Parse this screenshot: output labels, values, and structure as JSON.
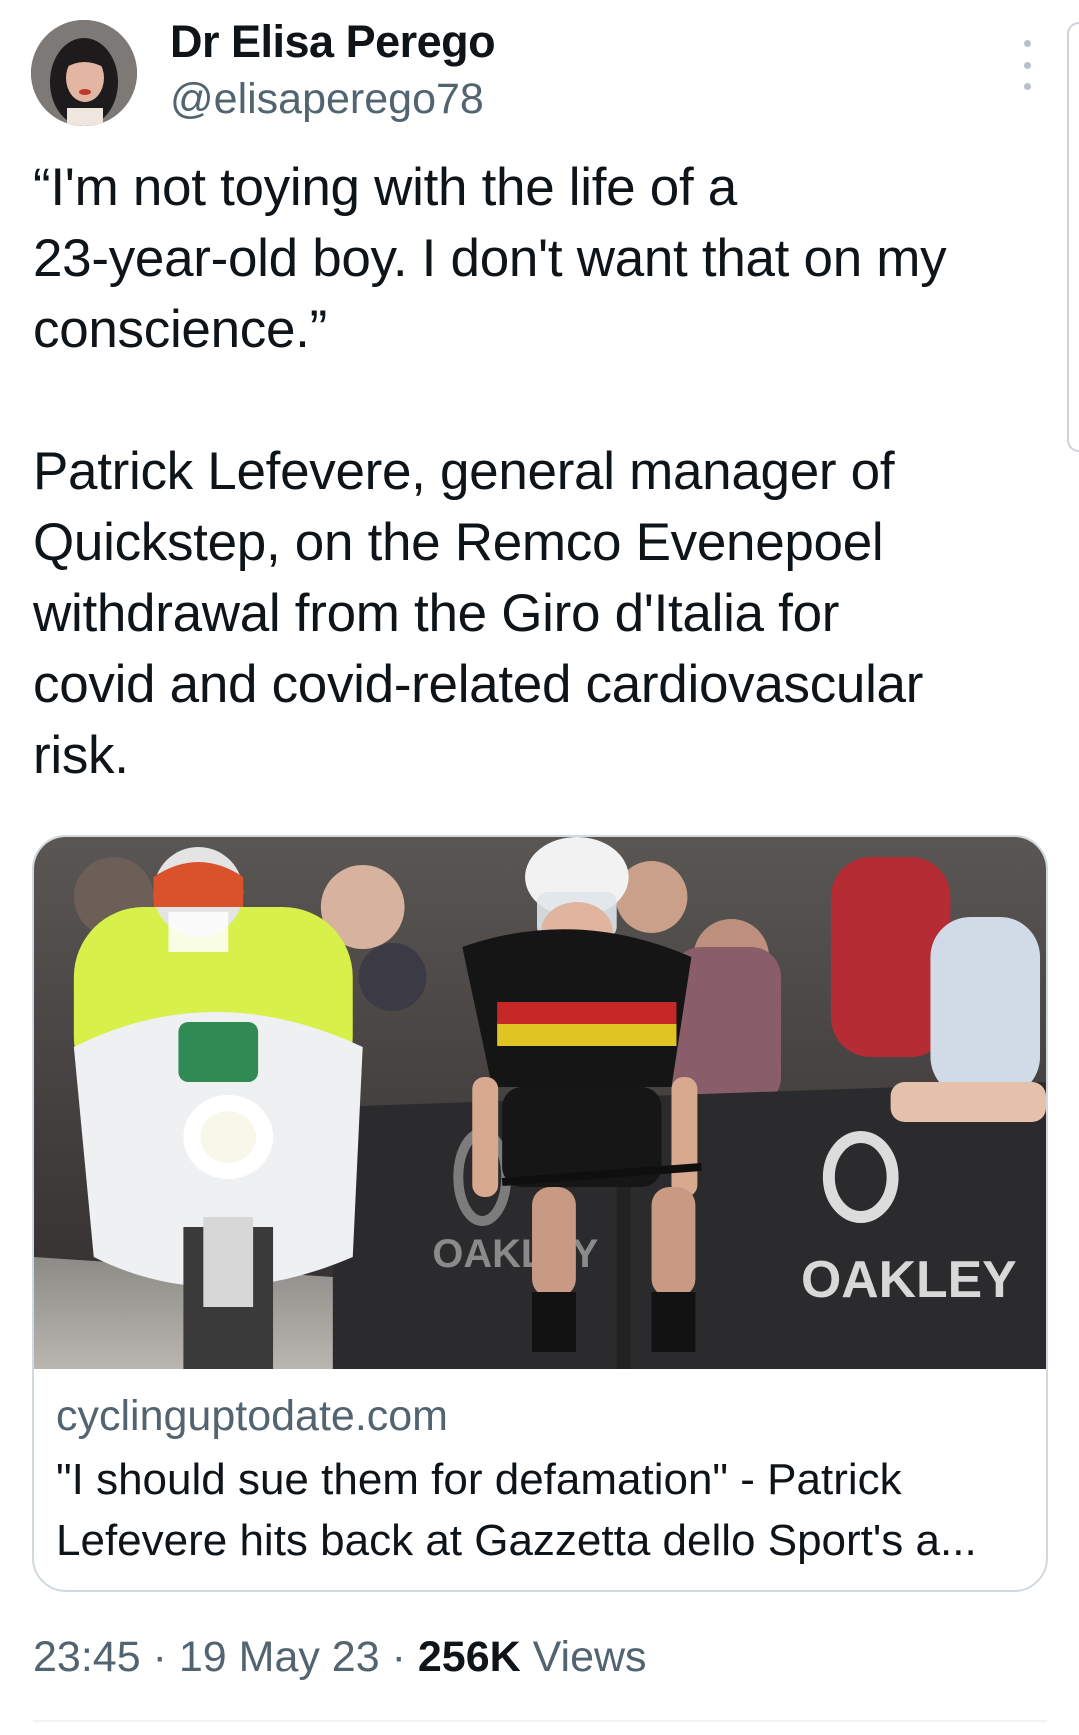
{
  "author": {
    "display_name": "Dr Elisa Perego",
    "handle": "@elisaperego78"
  },
  "tweet": {
    "lines": [
      "“I'm not toying with the life of a",
      "23-year-old boy. I don't want that on my",
      "conscience.”",
      "Patrick Lefevere, general manager of",
      "Quickstep, on the Remco Evenepoel",
      "withdrawal from the Giro d'Italia for",
      "covid and covid-related cardiovascular",
      "risk."
    ]
  },
  "link_card": {
    "domain": "cyclinguptodate.com",
    "title_line1": "\"I should sue them for defamation\" - Patrick",
    "title_line2": "Lefevere hits back at Gazzetta dello Sport's a...",
    "image_banner_text_1": "OAKLEY",
    "image_banner_text_2": "OAKLEY"
  },
  "meta": {
    "time": "23:45",
    "separator": "·",
    "date": "19 May 23",
    "views_count": "256K",
    "views_label": "Views"
  },
  "icons": {
    "more": "more-vertical-icon"
  }
}
